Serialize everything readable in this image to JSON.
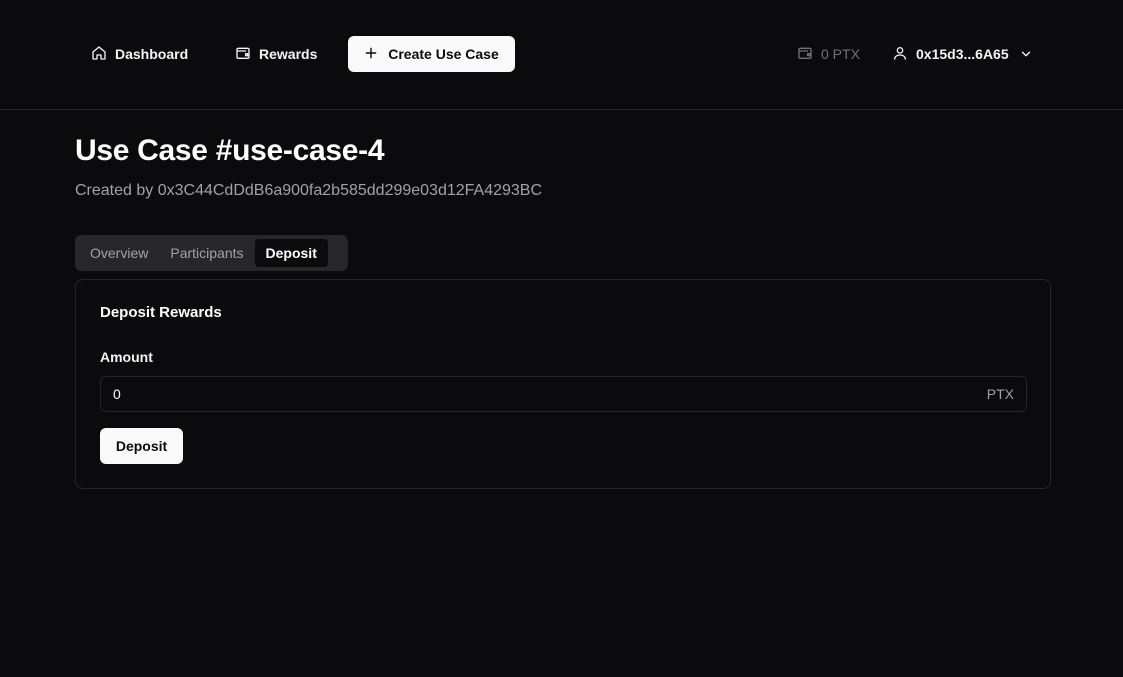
{
  "nav": {
    "dashboard": {
      "label": "Dashboard",
      "icon": "home-icon"
    },
    "rewards": {
      "label": "Rewards",
      "icon": "wallet-icon"
    },
    "create_button": {
      "label": "Create Use Case",
      "icon": "plus-icon"
    }
  },
  "header": {
    "balance": {
      "label": "0 PTX",
      "icon": "wallet-icon"
    },
    "account": {
      "address": "0x15d3...6A65",
      "icon": "user-icon",
      "dropdown_icon": "chevron-down-icon"
    }
  },
  "page": {
    "title": "Use Case #use-case-4",
    "creator": "Created by 0x3C44CdDdB6a900fa2b585dd299e03d12FA4293BC"
  },
  "tabs": [
    {
      "label": "Overview",
      "active": false
    },
    {
      "label": "Participants",
      "active": false
    },
    {
      "label": "Deposit",
      "active": true
    }
  ],
  "deposit_card": {
    "title": "Deposit Rewards",
    "amount_label": "Amount",
    "amount_value": "0",
    "amount_unit": "PTX",
    "button_label": "Deposit"
  },
  "colors": {
    "background": "#0b0b0d",
    "border": "#27272a",
    "muted_text": "#a1a1aa",
    "primary_button": "#fafafa"
  }
}
